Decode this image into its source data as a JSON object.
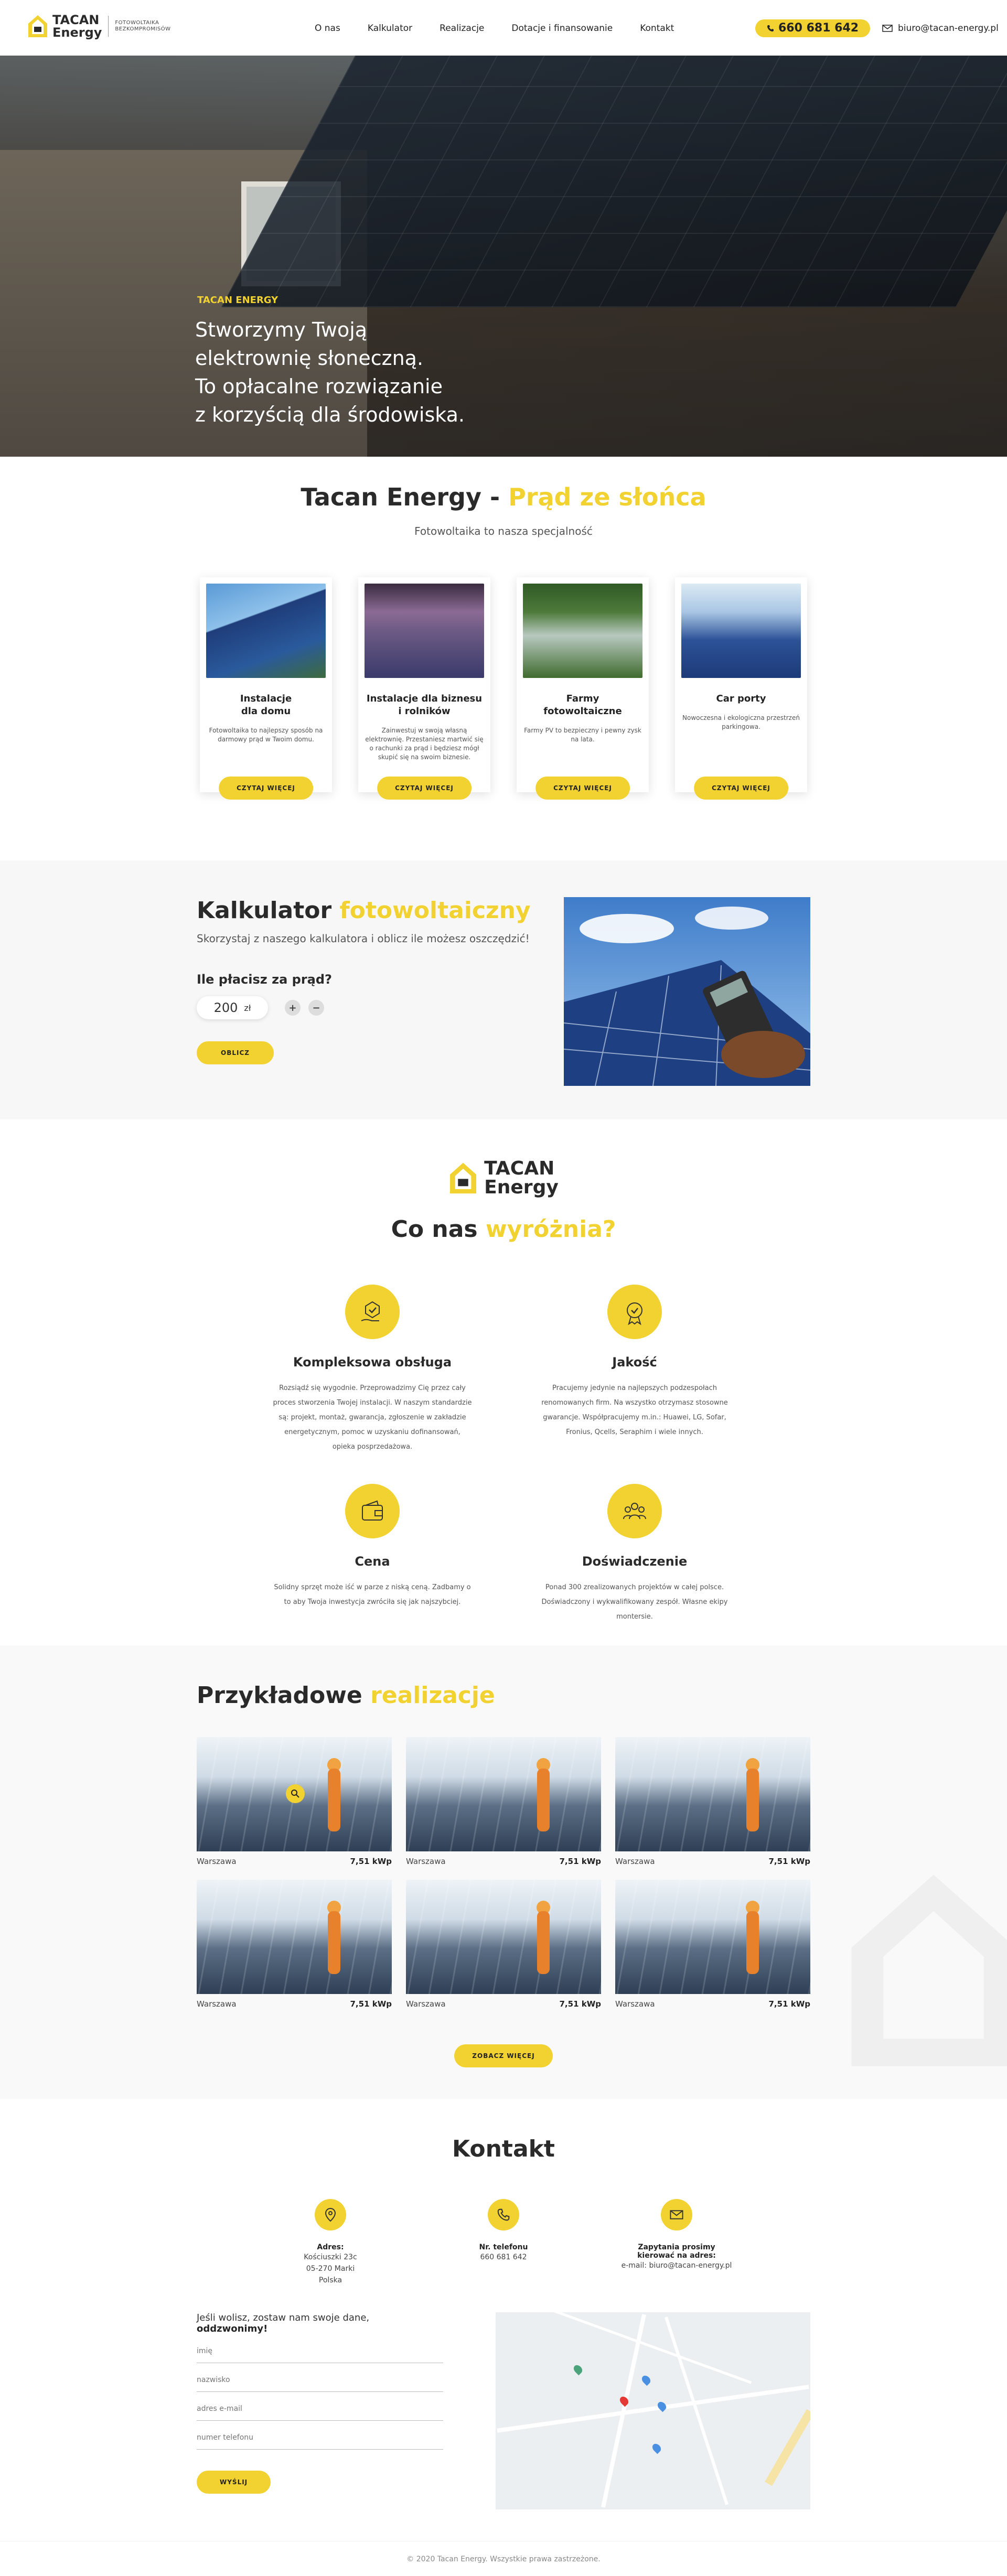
{
  "header": {
    "logo_line1": "TACAN",
    "logo_line2": "Energy",
    "logo_tag1": "Fotowoltaika",
    "logo_tag2": "bezkompromisów",
    "nav": [
      "O nas",
      "Kalkulator",
      "Realizacje",
      "Dotacje i finansowanie",
      "Kontakt"
    ],
    "phone": "660 681 642",
    "email": "biuro@tacan-energy.pl"
  },
  "hero": {
    "tag": "TACAN ENERGY",
    "line1": "Stworzymy Twoją",
    "line2": "elektrownię słoneczną.",
    "line3": "To opłacalne rozwiązanie",
    "line4": "z korzyścią dla środowiska."
  },
  "intro": {
    "title_a": "Tacan Energy - ",
    "title_b": "Prąd ze słońca",
    "subtitle": "Fotowoltaika to nasza specjalność",
    "cards": [
      {
        "title1": "Instalacje",
        "title2": "dla domu",
        "text": "Fotowoltaika to najlepszy sposób na darmowy prąd w Twoim domu.",
        "button": "CZYTAJ WIĘCEJ"
      },
      {
        "title1": "Instalacje dla biznesu",
        "title2": "i rolników",
        "text": "Zainwestuj w swoją własną elektrownię. Przestaniesz martwić się o rachunki za prąd i będziesz mógł skupić się na swoim biznesie.",
        "button": "CZYTAJ WIĘCEJ"
      },
      {
        "title1": "Farmy",
        "title2": "fotowoltaiczne",
        "text": "Farmy PV to bezpieczny i pewny zysk na lata.",
        "button": "CZYTAJ WIĘCEJ"
      },
      {
        "title1": "Car porty",
        "title2": "",
        "text": "Nowoczesna i ekologiczna przestrzeń parkingowa.",
        "button": "CZYTAJ WIĘCEJ"
      }
    ]
  },
  "calculator": {
    "title_a": "Kalkulator ",
    "title_b": "fotowoltaiczny",
    "subtitle": "Skorzystaj z naszego kalkulatora i oblicz ile możesz oszczędzić!",
    "question": "Ile płacisz za prąd?",
    "amount": "200",
    "currency": "zł",
    "plus": "+",
    "minus": "−",
    "button": "OBLICZ"
  },
  "features": {
    "logo_line1": "TACAN",
    "logo_line2": "Energy",
    "title_a": "Co nas ",
    "title_b": "wyróżnia?",
    "items": [
      {
        "title": "Kompleksowa obsługa",
        "text": "Rozsiądź się wygodnie. Przeprowadzimy Cię przez cały proces stworzenia Twojej instalacji. W naszym standardzie są: projekt, montaż, gwarancja, zgłoszenie w zakładzie energetycznym, pomoc w uzyskaniu dofinansowań, opieka posprzedażowa.",
        "icon": "hand-heart-icon"
      },
      {
        "title": "Jakość",
        "text": "Pracujemy jedynie na najlepszych podzespołach renomowanych firm. Na wszystko otrzymasz stosowne gwarancje. Współpracujemy m.in.: Huawei, LG, Sofar, Fronius, Qcells, Seraphim i wiele innych.",
        "icon": "quality-badge-icon"
      },
      {
        "title": "Cena",
        "text": "Solidny sprzęt może iść w parze z niską ceną. Zadbamy o to aby Twoja inwestycja zwróciła się jak najszybciej.",
        "icon": "wallet-icon"
      },
      {
        "title": "Doświadczenie",
        "text": "Ponad 300 zrealizowanych projektów w całej polsce. Doświadczony i wykwalifikowany zespół. Własne ekipy montersie.",
        "icon": "team-icon"
      }
    ]
  },
  "realizations": {
    "title_a": "Przykładowe ",
    "title_b": "realizacje",
    "items": [
      {
        "city": "Warszawa",
        "power": "7,51 kWp"
      },
      {
        "city": "Warszawa",
        "power": "7,51 kWp"
      },
      {
        "city": "Warszawa",
        "power": "7,51 kWp"
      },
      {
        "city": "Warszawa",
        "power": "7,51 kWp"
      },
      {
        "city": "Warszawa",
        "power": "7,51 kWp"
      },
      {
        "city": "Warszawa",
        "power": "7,51 kWp"
      }
    ],
    "button": "ZOBACZ WIĘCEJ"
  },
  "contact": {
    "title": "Kontakt",
    "address_label": "Adres:",
    "address_1": "Kościuszki 23c",
    "address_2": "05-270 Marki",
    "address_3": "Polska",
    "phone_label": "Nr. telefonu",
    "phone": "660 681 642",
    "mail_label_1": "Zapytania prosimy",
    "mail_label_2": "kierować na adres:",
    "mail": "e-mail: biuro@tacan-energy.pl",
    "lead_a": "Jeśli wolisz, zostaw nam swoje dane, ",
    "lead_b": "oddzwonimy!",
    "fields": {
      "name": "imię",
      "surname": "nazwisko",
      "email": "adres e-mail",
      "phone": "numer telefonu"
    },
    "button": "WYŚLIJ"
  },
  "footer": {
    "text": "© 2020 Tacan Energy. Wszystkie prawa zastrzeżone."
  },
  "colors": {
    "accent": "#f2d230",
    "text": "#2a2a2a"
  }
}
